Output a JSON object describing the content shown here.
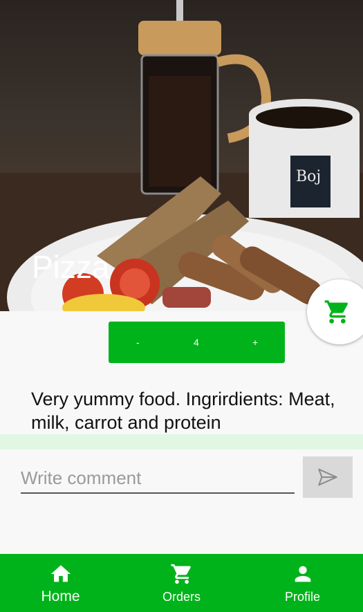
{
  "product": {
    "title": "Pizza",
    "quantity": "4",
    "decrement_label": "-",
    "increment_label": "+",
    "description": "Very yummy food. Ingrirdients: Meat, milk, carrot and protein"
  },
  "comment": {
    "placeholder": "Write comment",
    "value": ""
  },
  "icons": {
    "cart_fab": "shopping-cart-icon",
    "send": "send-icon"
  },
  "bottom_nav": {
    "items": [
      {
        "label": "Home",
        "icon": "home-icon",
        "active": true
      },
      {
        "label": "Orders",
        "icon": "shopping-cart-icon",
        "active": false
      },
      {
        "label": "Profile",
        "icon": "person-icon",
        "active": false
      }
    ]
  },
  "colors": {
    "accent": "#00b31a",
    "highlight_strip": "#e2f7e3",
    "send_button_bg": "#d9d9d9",
    "background": "#f8f8f8"
  }
}
